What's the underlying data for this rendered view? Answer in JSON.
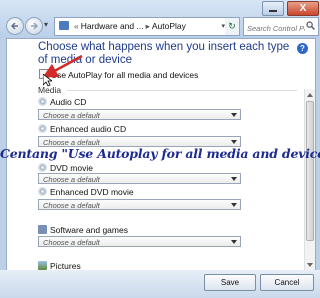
{
  "address": {
    "segments": [
      "Hardware and ...",
      "AutoPlay"
    ],
    "search_placeholder": "Search Control Panel"
  },
  "window_controls": {
    "close": "X"
  },
  "heading": "Choose what happens when you insert each type of media or device",
  "autoplay_checkbox": {
    "label": "Use AutoPlay for all media and devices",
    "checked": false
  },
  "media_section_label": "Media",
  "media_items": [
    {
      "label": "Audio CD",
      "icon": "disc-icon",
      "select": "Choose a default"
    },
    {
      "label": "Enhanced audio CD",
      "icon": "disc-icon",
      "select": "Choose a default"
    },
    {
      "label": "DVD movie",
      "icon": "disc-icon",
      "select": "Choose a default"
    },
    {
      "label": "Enhanced DVD movie",
      "icon": "disc-icon",
      "select": "Choose a default"
    },
    {
      "label": "Software and games",
      "icon": "box-icon",
      "select": "Choose a default"
    },
    {
      "label": "Pictures",
      "icon": "picture-icon",
      "select": ""
    }
  ],
  "buttons": {
    "save": "Save",
    "cancel": "Cancel"
  },
  "annotation": {
    "text": "Centang \"Use Autoplay for all media and devices\"",
    "arrow_color": "#d42a2a",
    "text_color": "#1d2a8f"
  }
}
